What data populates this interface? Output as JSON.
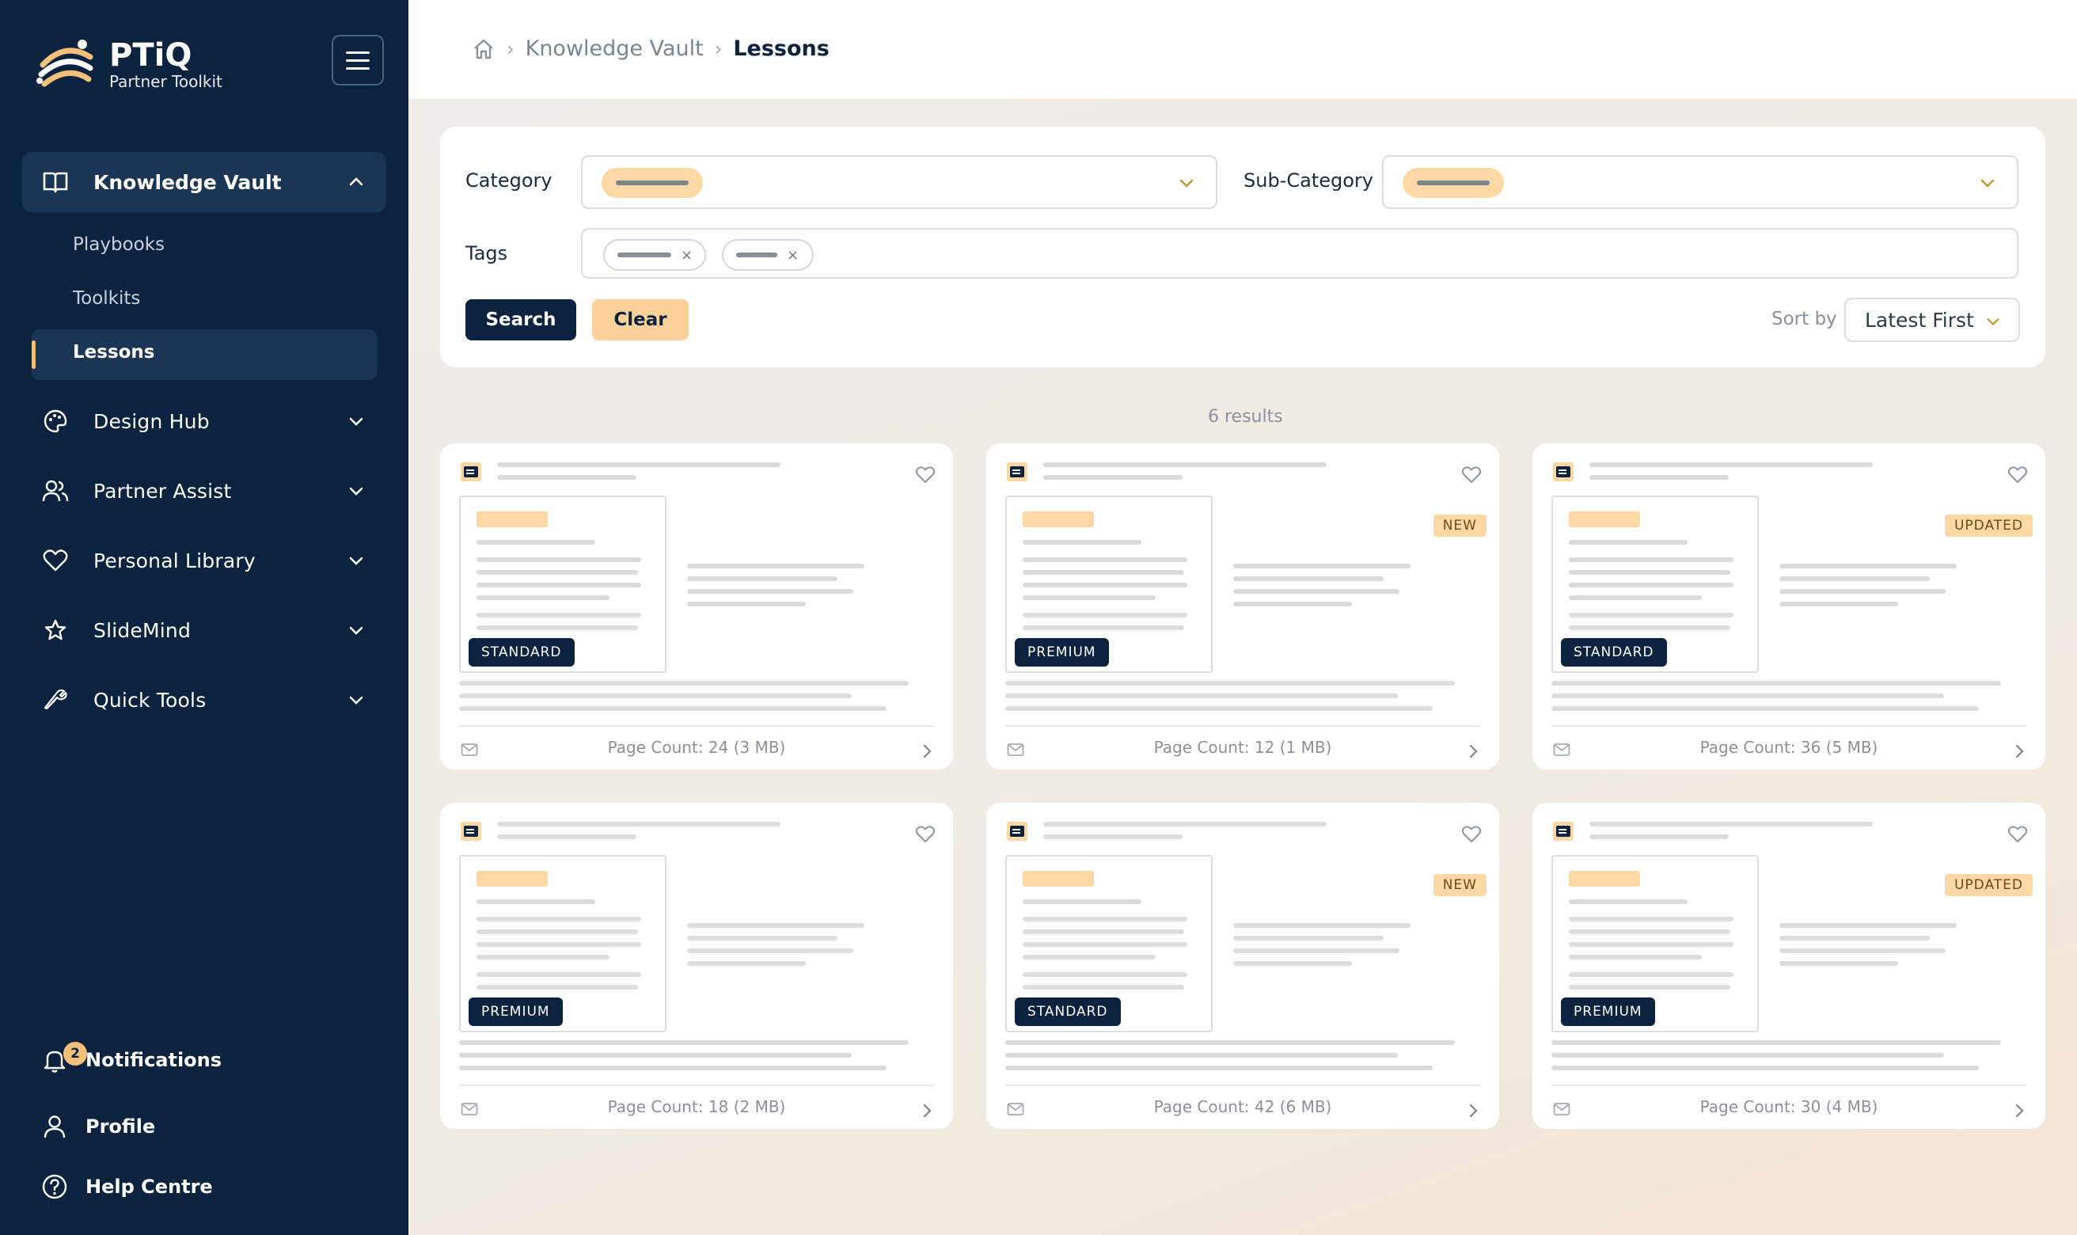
{
  "app": {
    "title": "PTiQ",
    "subtitle": "Partner Toolkit"
  },
  "sidebar": {
    "groups": [
      {
        "label": "Knowledge Vault",
        "expanded": true,
        "icon": "book-icon",
        "items": [
          {
            "label": "Playbooks"
          },
          {
            "label": "Toolkits"
          },
          {
            "label": "Lessons",
            "active": true
          }
        ]
      },
      {
        "label": "Design Hub",
        "icon": "palette-icon"
      },
      {
        "label": "Partner Assist",
        "icon": "users-icon"
      },
      {
        "label": "Personal Library",
        "icon": "heart-icon"
      },
      {
        "label": "SlideMind",
        "icon": "star-icon"
      },
      {
        "label": "Quick Tools",
        "icon": "wrench-icon"
      }
    ],
    "bottom": {
      "notifications": {
        "label": "Notifications",
        "count": "2"
      },
      "profile": {
        "label": "Profile"
      },
      "help": {
        "label": "Help Centre"
      }
    }
  },
  "breadcrumb": {
    "items": [
      "Knowledge Vault",
      "Lessons"
    ],
    "separator": "›"
  },
  "filters": {
    "category_label": "Category",
    "subcategory_label": "Sub-Category",
    "tags_label": "Tags",
    "search_label": "Search",
    "clear_label": "Clear",
    "sort_label": "Sort by",
    "sort_value": "Latest First"
  },
  "results": {
    "count_text": "6 results"
  },
  "cards": [
    {
      "tier": "STANDARD",
      "status": "",
      "page_count": "Page Count: 24 (3 MB)"
    },
    {
      "tier": "PREMIUM",
      "status": "NEW",
      "page_count": "Page Count: 12 (1 MB)"
    },
    {
      "tier": "STANDARD",
      "status": "UPDATED",
      "page_count": "Page Count: 36 (5 MB)"
    },
    {
      "tier": "PREMIUM",
      "status": "",
      "page_count": "Page Count: 18 (2 MB)"
    },
    {
      "tier": "STANDARD",
      "status": "NEW",
      "page_count": "Page Count: 42 (6 MB)"
    },
    {
      "tier": "PREMIUM",
      "status": "UPDATED",
      "page_count": "Page Count: 30 (4 MB)"
    }
  ],
  "colors": {
    "sidebar": "#0c2340",
    "accent": "#fcd29a",
    "background": "#efebe4"
  }
}
